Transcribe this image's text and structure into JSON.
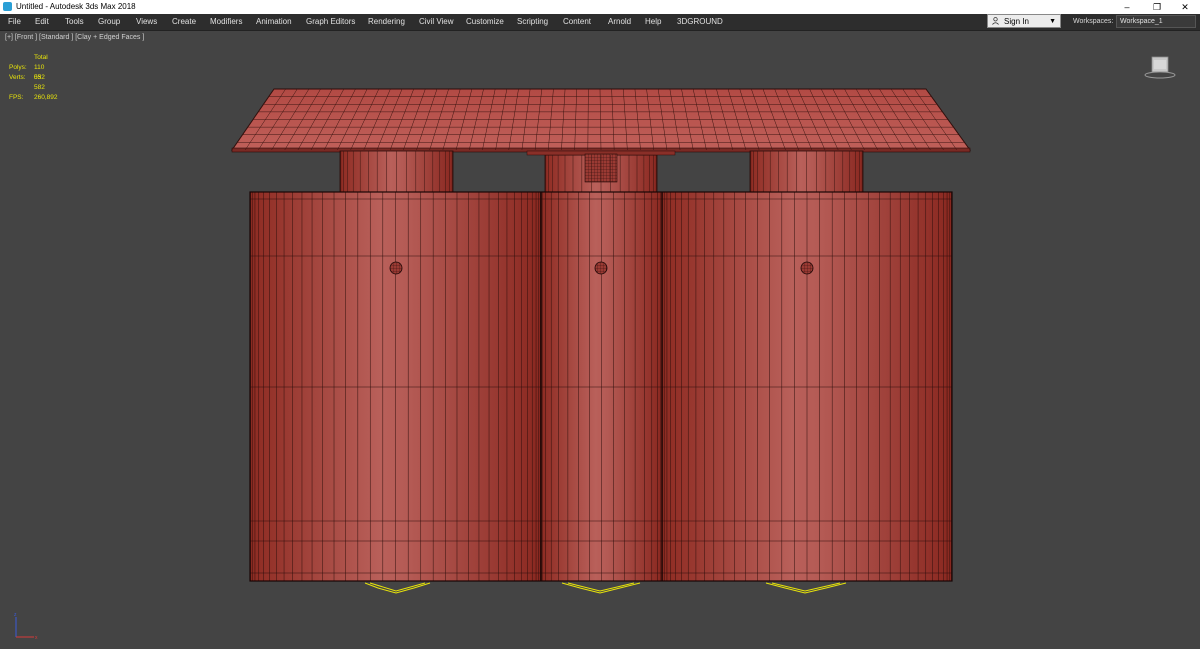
{
  "window": {
    "title": "Untitled - Autodesk 3ds Max 2018",
    "controls": {
      "minimize": "–",
      "maximize": "❐",
      "close": "✕"
    }
  },
  "menu": [
    "File",
    "Edit",
    "Tools",
    "Group",
    "Views",
    "Create",
    "Modifiers",
    "Animation",
    "Graph Editors",
    "Rendering",
    "Civil View",
    "Customize",
    "Scripting",
    "Content",
    "Arnold",
    "Help",
    "3DGROUND"
  ],
  "signin": {
    "label": "Sign In"
  },
  "workspaces": {
    "label": "Workspaces:",
    "value": "Workspace_1"
  },
  "viewport": {
    "label": "[+] [Front ] [Standard ] [Clay + Edged Faces ]",
    "stats": {
      "header": "Total",
      "polys_label": "Polys:",
      "polys": "110 032",
      "verts_label": "Verts:",
      "verts": "55 582",
      "fps_label": "FPS:",
      "fps": "260,892"
    }
  },
  "colors": {
    "mesh": "#b0413a",
    "wire": "#2a0c0a",
    "selection": "#e8e40a",
    "background": "#444444"
  }
}
